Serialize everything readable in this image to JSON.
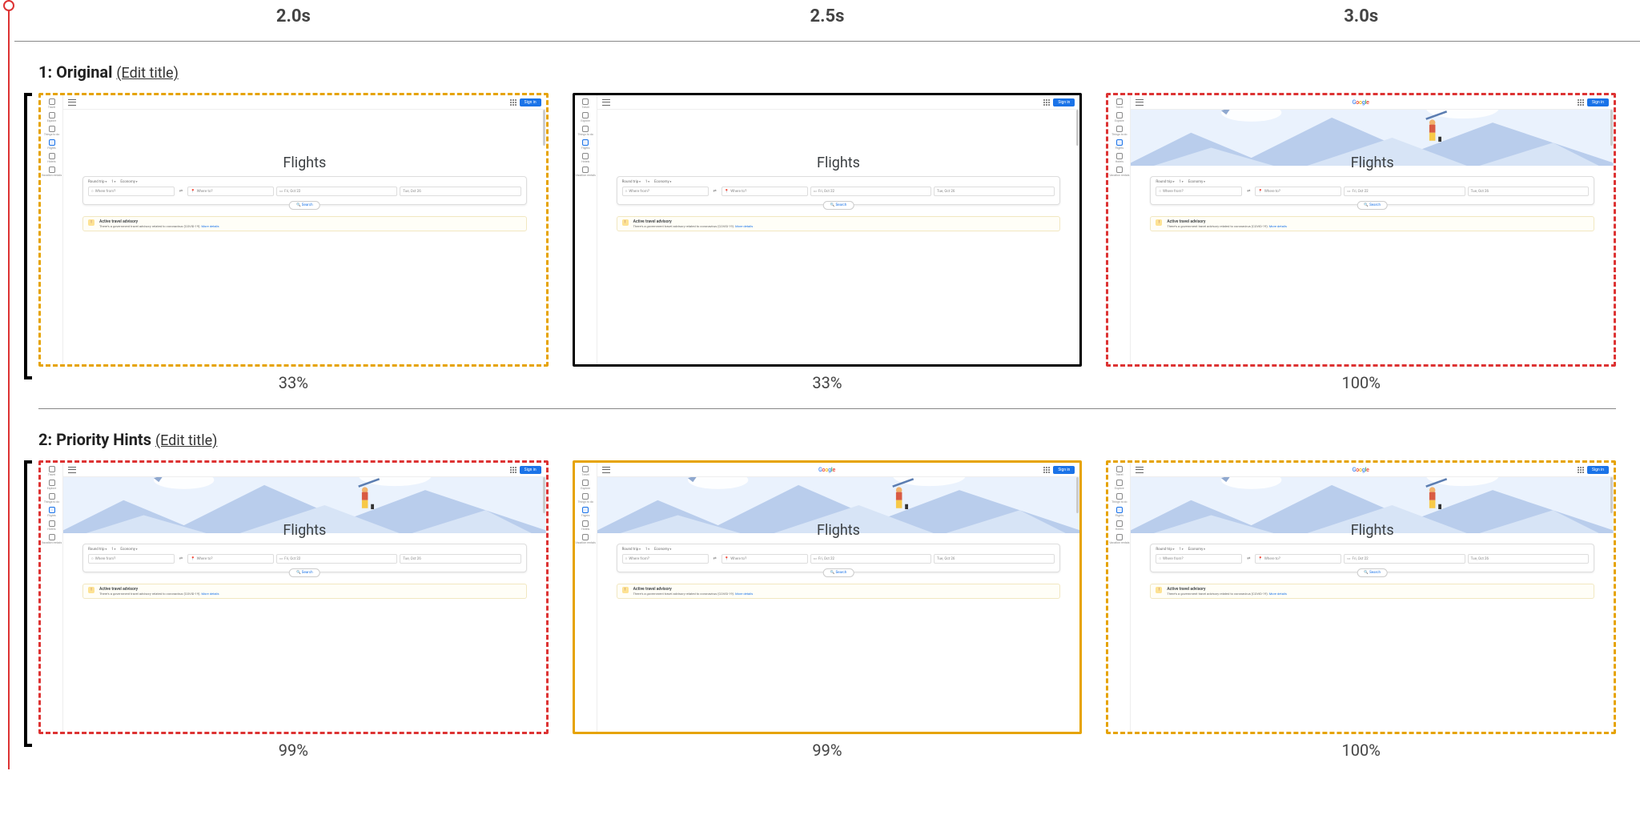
{
  "time_markers": [
    "2.0s",
    "2.5s",
    "3.0s"
  ],
  "edit_title_label": "(Edit title)",
  "rows": [
    {
      "id": "original",
      "label": "1: Original",
      "cells": [
        {
          "pct": "33%",
          "border": "dashed-orange",
          "hero_loaded": false,
          "logo_loaded": false
        },
        {
          "pct": "33%",
          "border": "solid-black",
          "hero_loaded": false,
          "logo_loaded": false
        },
        {
          "pct": "100%",
          "border": "dashed-red",
          "hero_loaded": true,
          "logo_loaded": true
        }
      ]
    },
    {
      "id": "priority-hints",
      "label": "2: Priority Hints",
      "cells": [
        {
          "pct": "99%",
          "border": "dashed-red",
          "hero_loaded": true,
          "logo_loaded": false
        },
        {
          "pct": "99%",
          "border": "solid-orange",
          "hero_loaded": true,
          "logo_loaded": true
        },
        {
          "pct": "100%",
          "border": "dashed-orange",
          "hero_loaded": true,
          "logo_loaded": true
        }
      ]
    }
  ],
  "flights": {
    "title": "Flights",
    "sign_in": "Sign in",
    "logo_text": "Google",
    "sidebar": [
      "Travel",
      "Explore",
      "Things to do",
      "Flights",
      "Hotels",
      "Vacation rentals"
    ],
    "sidebar_active_index": 3,
    "options": {
      "trip": "Round trip",
      "pax": "1",
      "class": "Economy"
    },
    "fields": {
      "from_placeholder": "Where from?",
      "to_placeholder": "Where to?",
      "date1": "Fri, Oct 22",
      "date2": "Tue, Oct 26"
    },
    "search_label": "Search",
    "advisory": {
      "title": "Active travel advisory",
      "desc": "There's a government travel advisory related to coronavirus (COVID-19).",
      "more": "More details"
    }
  }
}
